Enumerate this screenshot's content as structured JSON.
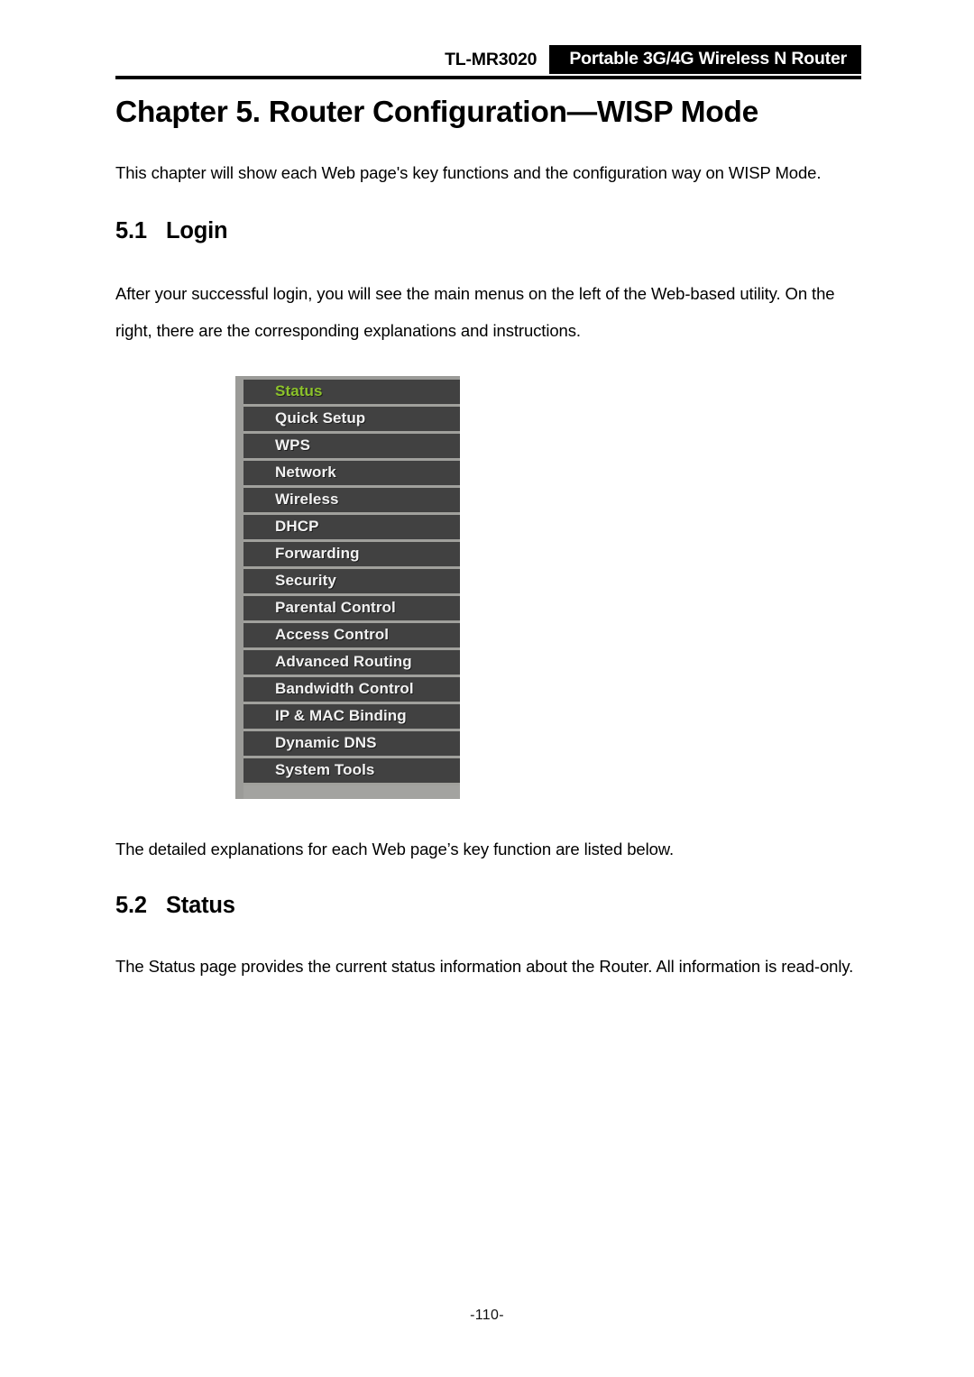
{
  "header": {
    "model": "TL-MR3020",
    "product": "Portable 3G/4G Wireless N Router"
  },
  "document": {
    "chapter_title": "Chapter 5. Router Configuration—WISP Mode",
    "intro_paragraph": "This chapter will show each Web page's key functions and the configuration way on WISP Mode.",
    "section_login": {
      "number": "5.1",
      "title": "Login",
      "paragraph": "After your successful login, you will see the main menus on the left of the Web-based utility. On the right, there are the corresponding explanations and instructions.",
      "caption_after_figure": "The detailed explanations for each Web page’s key function are listed below."
    },
    "section_status": {
      "number": "5.2",
      "title": "Status",
      "paragraph": "The Status page provides the current status information about the Router. All information is read-only."
    }
  },
  "router_menu": {
    "active_color": "#8cc22b",
    "item_color": "#f2f2f2",
    "background": "#414141",
    "items": [
      {
        "label": "Status",
        "active": true
      },
      {
        "label": "Quick Setup",
        "active": false
      },
      {
        "label": "WPS",
        "active": false
      },
      {
        "label": "Network",
        "active": false
      },
      {
        "label": "Wireless",
        "active": false
      },
      {
        "label": "DHCP",
        "active": false
      },
      {
        "label": "Forwarding",
        "active": false
      },
      {
        "label": "Security",
        "active": false
      },
      {
        "label": "Parental Control",
        "active": false
      },
      {
        "label": "Access Control",
        "active": false
      },
      {
        "label": "Advanced Routing",
        "active": false
      },
      {
        "label": "Bandwidth Control",
        "active": false
      },
      {
        "label": "IP & MAC Binding",
        "active": false
      },
      {
        "label": "Dynamic DNS",
        "active": false
      },
      {
        "label": "System Tools",
        "active": false
      }
    ]
  },
  "footer": {
    "page_number": "-110-"
  }
}
